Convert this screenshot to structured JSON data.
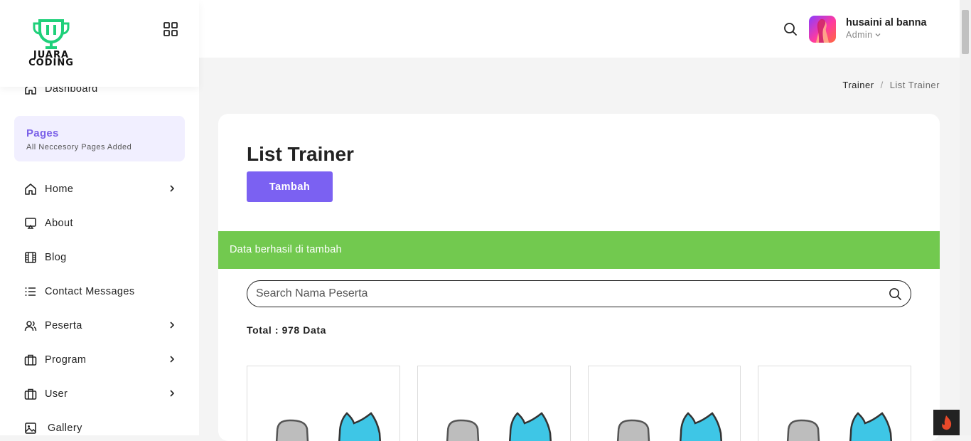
{
  "brand": {
    "line1": "JUARA",
    "line2": "CODING"
  },
  "sidebar": {
    "dashboard": "Dashboard",
    "section": {
      "title": "Pages",
      "subtitle": "All Neccesory Pages Added"
    },
    "items": [
      {
        "label": "Home",
        "icon": "home-icon",
        "has_children": true
      },
      {
        "label": "About",
        "icon": "monitor-icon",
        "has_children": false
      },
      {
        "label": "Blog",
        "icon": "film-icon",
        "has_children": false
      },
      {
        "label": "Contact Messages",
        "icon": "list-icon",
        "has_children": false
      },
      {
        "label": "Peserta",
        "icon": "users-icon",
        "has_children": true
      },
      {
        "label": "Program",
        "icon": "briefcase-icon",
        "has_children": true
      },
      {
        "label": "User",
        "icon": "briefcase-icon",
        "has_children": true
      },
      {
        "label": "Gallery",
        "icon": "image-icon",
        "has_children": false
      }
    ]
  },
  "header": {
    "user": {
      "name": "husaini al banna",
      "role": "Admin"
    }
  },
  "breadcrumb": {
    "parent": "Trainer",
    "separator": "/",
    "current": "List Trainer"
  },
  "main": {
    "title": "List Trainer",
    "add_button": "Tambah",
    "alert": "Data berhasil di tambah",
    "search": {
      "placeholder": "Search Nama Peserta"
    },
    "total": "Total : 978 Data",
    "card_count": 4
  },
  "colors": {
    "accent": "#7b61f2",
    "alert_green": "#72c94f",
    "logo_green": "#1fd07a",
    "pages_bg": "#f1efff"
  }
}
